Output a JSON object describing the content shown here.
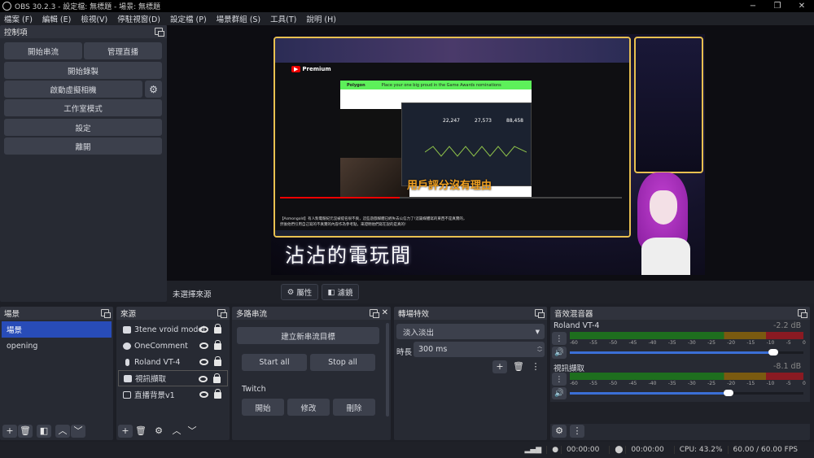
{
  "window": {
    "title": "OBS 30.2.3 - 設定檔: 無標題 - 場景: 無標題",
    "minimize": "−",
    "maximize": "❐",
    "close": "✕"
  },
  "menu": [
    "檔案 (F)",
    "編輯 (E)",
    "檢視(V)",
    "停駐視窗(D)",
    "設定檔 (P)",
    "場景群組 (S)",
    "工具(T)",
    "說明 (H)"
  ],
  "controls": {
    "title": "控制項",
    "start_stream": "開始串流",
    "manage_broadcast": "管理直播",
    "start_recording": "開始錄製",
    "start_virtual_camera": "啟動虛擬相機",
    "studio_mode": "工作室模式",
    "settings": "設定",
    "exit": "離開"
  },
  "preview": {
    "overlay_title": "沾沾的電玩間",
    "video_subtitle": "用戶評分沒有理由",
    "site_name": "Polygon",
    "site_banner": "Place your one big proud in the Game Awards nominations",
    "yt_brand": "Premium",
    "description_1": "【Asmongold】有人對電競紀元沒被提名很不爽，這些遊戲媒體已經失去公信力了!這篇媒體寫的東西不是真實的，",
    "description_2": "然後他們引用自己寫的不真實的內容作為參考點，來證明他們寫在說的是真的!",
    "stats": [
      "22,247",
      "27,573",
      "88,458"
    ]
  },
  "source_bar": {
    "no_source": "未選擇來源",
    "properties": "屬性",
    "filters": "濾鏡"
  },
  "scenes": {
    "title": "場景",
    "items": [
      {
        "label": "場景",
        "selected": true
      },
      {
        "label": "opening",
        "selected": false
      }
    ]
  },
  "sources": {
    "title": "來源",
    "items": [
      {
        "label": "3tene vroid model",
        "icon": "camera-icon"
      },
      {
        "label": "OneComment",
        "icon": "browser-icon"
      },
      {
        "label": "Roland VT-4",
        "icon": "microphone-icon"
      },
      {
        "label": "視訊擷取",
        "icon": "camera-icon"
      },
      {
        "label": "直播背景v1",
        "icon": "image-icon"
      }
    ]
  },
  "multistream": {
    "title": "多路串流",
    "new_target": "建立新串流目標",
    "start_all": "Start all",
    "stop_all": "Stop all",
    "target_name": "Twitch",
    "start": "開始",
    "edit": "修改",
    "delete": "刪除"
  },
  "transitions": {
    "title": "轉場特效",
    "selected": "淡入淡出",
    "duration_label": "時長",
    "duration_value": "300 ms"
  },
  "mixer": {
    "title": "音效混音器",
    "scale": [
      "-60",
      "-55",
      "-50",
      "-45",
      "-40",
      "-35",
      "-30",
      "-25",
      "-20",
      "-15",
      "-10",
      "-5",
      "0"
    ],
    "channels": [
      {
        "name": "Roland VT-4",
        "db": "-2.2 dB",
        "fader_percent": 87
      },
      {
        "name": "視訊擷取",
        "db": "-8.1 dB",
        "fader_percent": 68
      }
    ]
  },
  "status": {
    "stream_time": "00:00:00",
    "record_time": "00:00:00",
    "cpu": "CPU: 43.2%",
    "fps": "60.00 / 60.00 FPS"
  },
  "colors": {
    "accent": "#284cb8",
    "dock": "#272a33",
    "button": "#3c404c",
    "meter_green": "#1e6e1e",
    "meter_yellow": "#7a5a10",
    "meter_red": "#8a1a22",
    "frame_gold": "#e8c050"
  }
}
